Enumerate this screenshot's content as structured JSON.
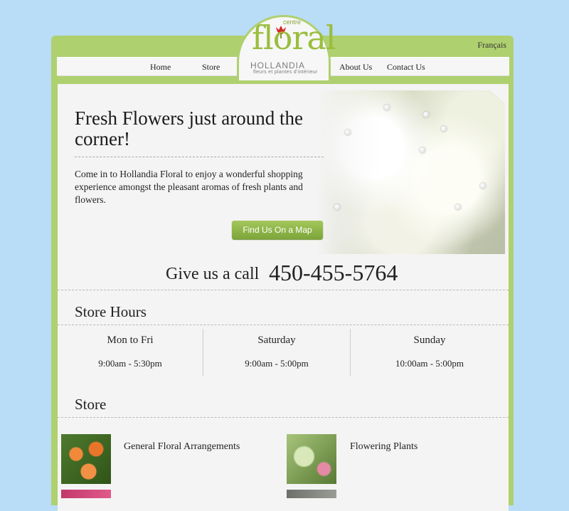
{
  "header": {
    "language_link": "Français",
    "logo": {
      "brand": "floral",
      "prefix": "centre",
      "name": "HOLLANDIA",
      "tagline": "fleurs et plantes d'intérieur"
    }
  },
  "nav": {
    "items": [
      "Home",
      "Store",
      "About Us",
      "Contact Us"
    ]
  },
  "hero": {
    "title": "Fresh Flowers just around the corner!",
    "body": "Come in to Hollandia Floral to enjoy a wonderful shopping experience amongst the pleasant aromas of fresh plants and flowers.",
    "button": "Find Us On a Map"
  },
  "call": {
    "label": "Give us a call",
    "phone": "450-455-5764"
  },
  "hours": {
    "title": "Store Hours",
    "days": [
      {
        "day": "Mon to Fri",
        "time": "9:00am - 5:30pm"
      },
      {
        "day": "Saturday",
        "time": "9:00am - 5:00pm"
      },
      {
        "day": "Sunday",
        "time": "10:00am - 5:00pm"
      }
    ]
  },
  "store": {
    "title": "Store",
    "items": [
      "General Floral Arrangements",
      "Flowering Plants"
    ]
  },
  "colors": {
    "frame": "#afd06f",
    "background": "#b9dcf7",
    "button": "#8cb347"
  }
}
